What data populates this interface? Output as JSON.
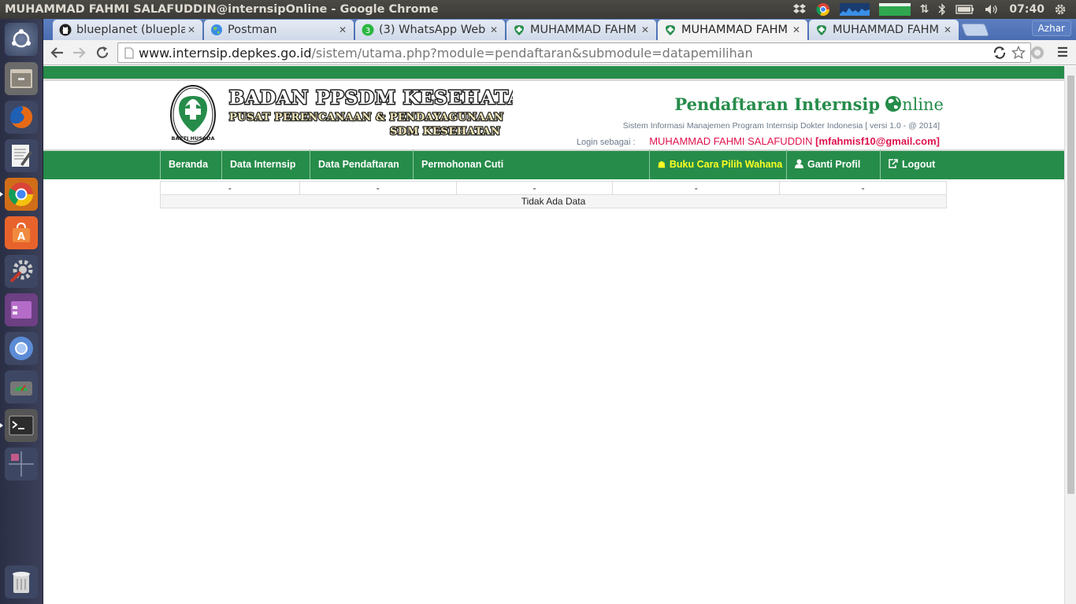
{
  "window": {
    "title": "MUHAMMAD FAHMI SALAFUDDIN@internsipOnline - Google Chrome"
  },
  "tray": {
    "time": "07:40"
  },
  "launcher": {
    "items": [
      "dash-icon",
      "files-icon",
      "firefox-icon",
      "text-editor-icon",
      "chrome-icon",
      "software-center-icon",
      "system-settings-icon",
      "app-icon",
      "chromium-icon",
      "disk-usage-icon",
      "terminal-icon",
      "workspace-switcher-icon",
      "trash-icon"
    ]
  },
  "browser": {
    "tabs": [
      {
        "label": "blueplanet (bluepla"
      },
      {
        "label": "Postman"
      },
      {
        "label": "(3) WhatsApp Web"
      },
      {
        "label": "MUHAMMAD FAHM"
      },
      {
        "label": "MUHAMMAD FAHM"
      },
      {
        "label": "MUHAMMAD FAHM"
      }
    ],
    "active_tab": 4,
    "profile": "Azhar",
    "url_host": "www.internsip.depkes.go.id",
    "url_path": "/sistem/utama.php?module=pendaftaran&submodule=datapemilihan"
  },
  "site": {
    "logo_line1": "BADAN PPSDM KESEHATAN",
    "logo_line2": "PUSAT PERENCANAAN & PENDAYAGUNAAN",
    "logo_line3": "SDM KESEHATAN",
    "emblem_text": "BAKTI HUSADA",
    "title_main": "Pendaftaran Internsip",
    "title_suffix": "nline",
    "subtitle": "Sistem Informasi Manajemen Program Internsip Dokter Indonesia [ versi 1.0 - @ 2014]",
    "login_label": "Login sebagai :",
    "login_name": "MUHAMMAD FAHMI SALAFUDDIN",
    "login_email": "[mfahmisf10@gmail.com]"
  },
  "nav": {
    "beranda": "Beranda",
    "data_internsip": "Data Internsip",
    "data_pendaftaran": "Data Pendaftaran",
    "permohonan_cuti": "Permohonan Cuti",
    "buku": "Buku Cara Pilih Wahana",
    "ganti_profil": "Ganti Profil",
    "logout": "Logout"
  },
  "table": {
    "row": [
      "-",
      "-",
      "-",
      "-",
      "-"
    ],
    "empty_message": "Tidak Ada Data"
  },
  "colors": {
    "brand_green": "#268c4a",
    "highlight_yellow": "#ffff22",
    "login_red": "#e0134d"
  }
}
